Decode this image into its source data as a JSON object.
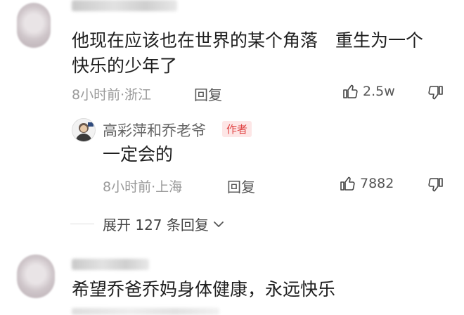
{
  "comment1": {
    "text": "他现在应该也在世界的某个角落　重生为一个快乐的少年了",
    "time_location": "8小时前·浙江",
    "reply_label": "回复",
    "like_count": "2.5w"
  },
  "reply1": {
    "author": "高彩萍和乔老爷",
    "author_tag": "作者",
    "text": "一定会的",
    "time_location": "8小时前·上海",
    "reply_label": "回复",
    "like_count": "7882"
  },
  "expand": {
    "label": "展开 127 条回复"
  },
  "comment2": {
    "text": "希望乔爸乔妈身体健康，永远快乐"
  },
  "colors": {
    "author_tag_bg": "#fde6e6",
    "author_tag_text": "#e04444",
    "meta_gray": "#9a9a9a"
  },
  "icons": [
    "thumb-up-icon",
    "thumb-down-icon",
    "chevron-down-icon"
  ]
}
